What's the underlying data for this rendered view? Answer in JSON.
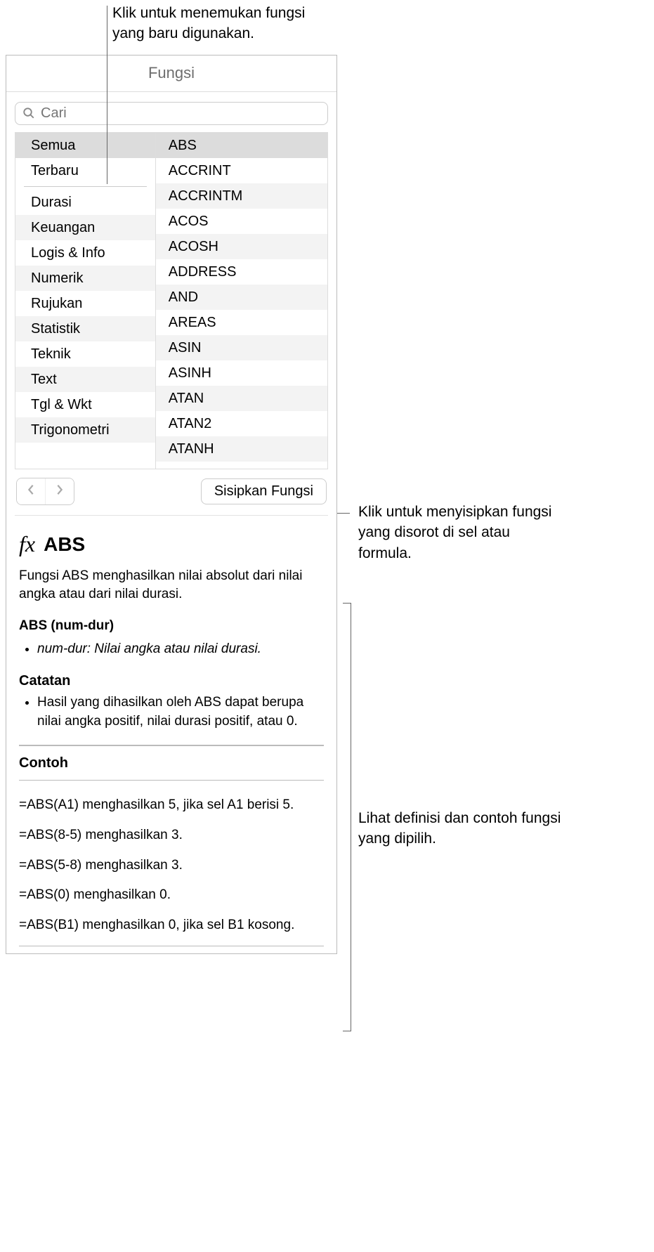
{
  "callouts": {
    "top": "Klik untuk menemukan fungsi yang baru digunakan.",
    "insert": "Klik untuk menyisipkan fungsi yang disorot di sel atau formula.",
    "detail": "Lihat definisi dan contoh fungsi yang dipilih."
  },
  "panel": {
    "title": "Fungsi",
    "search_placeholder": "Cari",
    "insert_button": "Sisipkan Fungsi"
  },
  "categories": [
    "Semua",
    "Terbaru",
    "Durasi",
    "Keuangan",
    "Logis & Info",
    "Numerik",
    "Rujukan",
    "Statistik",
    "Teknik",
    "Text",
    "Tgl & Wkt",
    "Trigonometri"
  ],
  "functions": [
    "ABS",
    "ACCRINT",
    "ACCRINTM",
    "ACOS",
    "ACOSH",
    "ADDRESS",
    "AND",
    "AREAS",
    "ASIN",
    "ASINH",
    "ATAN",
    "ATAN2",
    "ATANH"
  ],
  "detail": {
    "name": "ABS",
    "description": "Fungsi ABS menghasilkan nilai absolut dari nilai angka atau dari nilai durasi.",
    "syntax": "ABS (num-dur)",
    "args": [
      "num-dur: Nilai angka atau nilai durasi."
    ],
    "notes_title": "Catatan",
    "notes": [
      "Hasil yang dihasilkan oleh ABS dapat berupa nilai angka positif, nilai durasi positif, atau 0."
    ],
    "examples_title": "Contoh",
    "examples": [
      "=ABS(A1) menghasilkan 5, jika sel A1 berisi 5.",
      "=ABS(8-5) menghasilkan 3.",
      "=ABS(5-8) menghasilkan 3.",
      "=ABS(0) menghasilkan 0.",
      "=ABS(B1) menghasilkan 0, jika sel B1 kosong."
    ]
  }
}
